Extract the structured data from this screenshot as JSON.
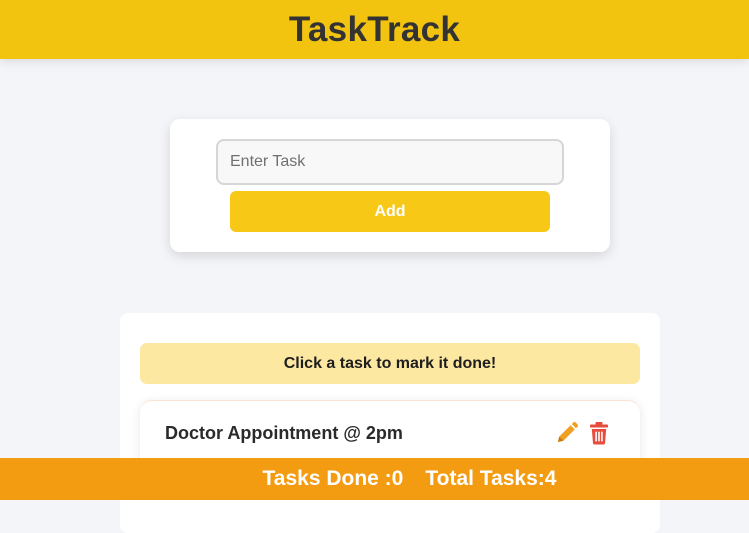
{
  "app": {
    "title": "TaskTrack"
  },
  "input_card": {
    "placeholder": "Enter Task",
    "value": "",
    "add_label": "Add"
  },
  "task_list": {
    "hint": "Click a task to mark it done!",
    "items": [
      {
        "text": "Doctor Appointment @ 2pm",
        "edit_icon": "pencil-icon",
        "delete_icon": "trash-icon"
      }
    ]
  },
  "footer": {
    "done_text": "Tasks Done :0",
    "total_text": "Total Tasks:4"
  },
  "colors": {
    "brand_yellow": "#f2c30f",
    "footer_orange": "#f39c12",
    "edit_icon": "#f0a020",
    "delete_icon": "#e74c3c"
  }
}
